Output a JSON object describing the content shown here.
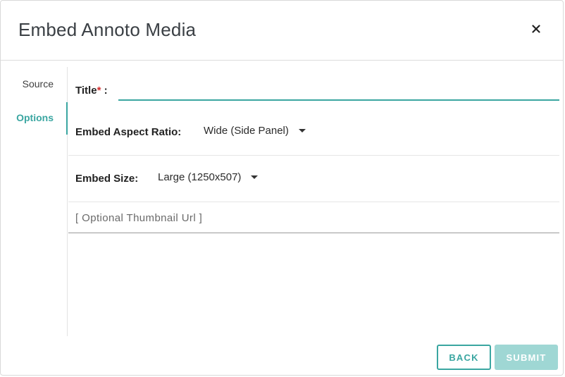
{
  "dialog": {
    "title": "Embed Annoto Media",
    "close_icon": "close-icon"
  },
  "sidebar": {
    "items": [
      {
        "label": "Source",
        "active": false
      },
      {
        "label": "Options",
        "active": true
      }
    ]
  },
  "form": {
    "title_label": "Title",
    "title_required_mark": "*",
    "title_colon": ":",
    "title_value": "",
    "aspect_label": "Embed Aspect Ratio:",
    "aspect_value": "Wide (Side Panel)",
    "size_label": "Embed Size:",
    "size_value": "Large (1250x507)",
    "thumbnail_placeholder": "[ Optional Thumbnail Url ]",
    "thumbnail_value": ""
  },
  "footer": {
    "back_label": "BACK",
    "submit_label": "SUBMIT"
  },
  "colors": {
    "accent": "#3aa6a1",
    "submit_disabled": "#9fd7d4",
    "required": "#d32f2f"
  }
}
